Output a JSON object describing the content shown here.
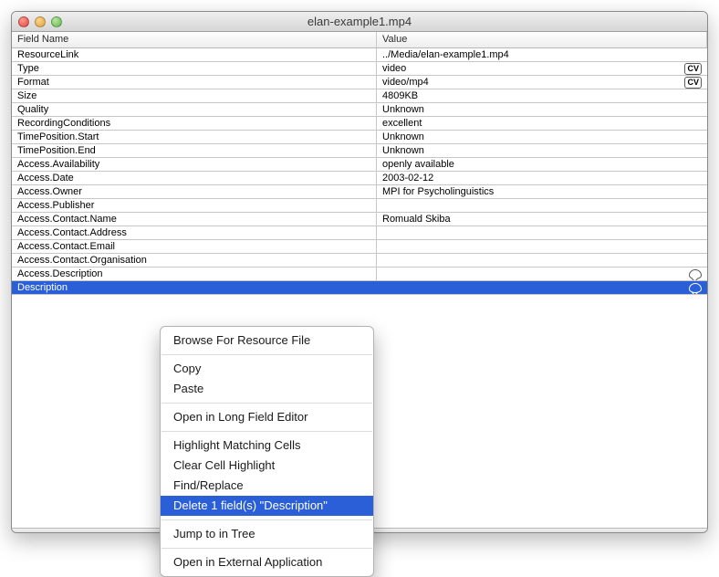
{
  "window": {
    "title": "elan-example1.mp4"
  },
  "table": {
    "headers": {
      "field": "Field Name",
      "value": "Value"
    },
    "rows": [
      {
        "name": "ResourceLink",
        "value": "../Media/elan-example1.mp4"
      },
      {
        "name": "Type",
        "value": "video",
        "badge": "cv"
      },
      {
        "name": "Format",
        "value": "video/mp4",
        "badge": "cv"
      },
      {
        "name": "Size",
        "value": "4809KB"
      },
      {
        "name": "Quality",
        "value": "Unknown"
      },
      {
        "name": "RecordingConditions",
        "value": "excellent"
      },
      {
        "name": "TimePosition.Start",
        "value": "Unknown"
      },
      {
        "name": "TimePosition.End",
        "value": "Unknown"
      },
      {
        "name": "Access.Availability",
        "value": "openly available"
      },
      {
        "name": "Access.Date",
        "value": "2003-02-12"
      },
      {
        "name": "Access.Owner",
        "value": "MPI for Psycholinguistics"
      },
      {
        "name": "Access.Publisher",
        "value": ""
      },
      {
        "name": "Access.Contact.Name",
        "value": "Romuald Skiba"
      },
      {
        "name": "Access.Contact.Address",
        "value": ""
      },
      {
        "name": "Access.Contact.Email",
        "value": ""
      },
      {
        "name": "Access.Contact.Organisation",
        "value": ""
      },
      {
        "name": "Access.Description",
        "value": "",
        "badge": "balloon"
      },
      {
        "name": "Description",
        "value": "",
        "badge": "balloon",
        "selected": true
      }
    ]
  },
  "badge_labels": {
    "cv": "CV"
  },
  "menu": {
    "items": [
      {
        "label": "Browse For Resource File"
      },
      {
        "sep": true
      },
      {
        "label": "Copy"
      },
      {
        "label": "Paste"
      },
      {
        "sep": true
      },
      {
        "label": "Open in Long Field Editor"
      },
      {
        "sep": true
      },
      {
        "label": "Highlight Matching Cells"
      },
      {
        "label": "Clear Cell Highlight"
      },
      {
        "label": "Find/Replace"
      },
      {
        "label": "Delete 1 field(s) \"Description\"",
        "highlight": true
      },
      {
        "sep": true
      },
      {
        "label": "Jump to in Tree"
      },
      {
        "sep": true
      },
      {
        "label": "Open in External Application"
      }
    ]
  }
}
